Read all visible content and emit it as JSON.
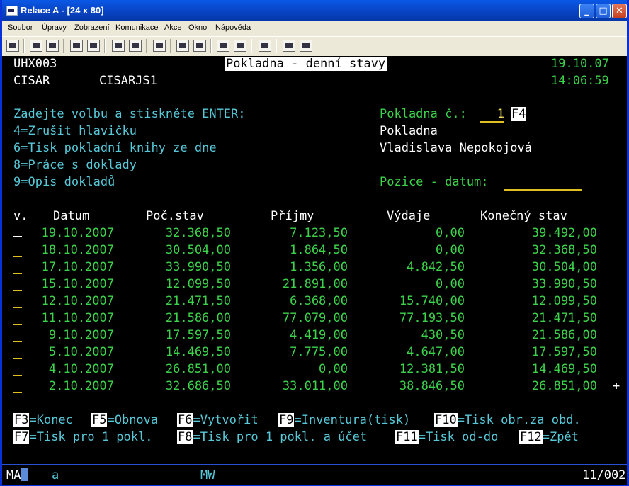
{
  "window": {
    "title": "Relace A - [24 x 80]"
  },
  "menu": [
    "Soubor",
    "Úpravy",
    "Zobrazení",
    "Komunikace",
    "Akce",
    "Okno",
    "Nápověda"
  ],
  "toolbar_icons": [
    "send-icon",
    "copy-icon",
    "paste-icon",
    "transfer-send-icon",
    "transfer-receive-icon",
    "display-icon",
    "display2-icon",
    "chart-icon",
    "record-start-icon",
    "record-stop-icon",
    "playback-icon",
    "playback2-icon",
    "clipboard-icon",
    "globe-icon",
    "tag-icon"
  ],
  "screen": {
    "program": "UHX003",
    "screen_title": "Pokladna - denní stavy",
    "date": "19.10.07",
    "user": "CISAR",
    "device": "CISARJS1",
    "time": "14:06:59",
    "instructions": [
      "Zadejte volbu a stiskněte ENTER:",
      "4=Zrušit hlavičku",
      "6=Tisk pokladní knihy ze dne",
      "8=Práce s doklady",
      "9=Opis dokladů"
    ],
    "register_label": "Pokladna č.:",
    "register_value": "1",
    "register_key": "F4",
    "register_name_label": "Pokladna",
    "register_owner": "Vladislava Nepokojová",
    "position_label": "Pozice - datum:",
    "position_value": "",
    "columns": [
      "v.",
      "Datum",
      "Poč.stav",
      "Příjmy",
      "Výdaje",
      "Konečný stav"
    ],
    "rows": [
      {
        "date": "19.10.2007",
        "start": "32.368,50",
        "income": "7.123,50",
        "expense": "0,00",
        "end": "39.492,00"
      },
      {
        "date": "18.10.2007",
        "start": "30.504,00",
        "income": "1.864,50",
        "expense": "0,00",
        "end": "32.368,50"
      },
      {
        "date": "17.10.2007",
        "start": "33.990,50",
        "income": "1.356,00",
        "expense": "4.842,50",
        "end": "30.504,00"
      },
      {
        "date": "15.10.2007",
        "start": "12.099,50",
        "income": "21.891,00",
        "expense": "0,00",
        "end": "33.990,50"
      },
      {
        "date": "12.10.2007",
        "start": "21.471,50",
        "income": "6.368,00",
        "expense": "15.740,00",
        "end": "12.099,50"
      },
      {
        "date": "11.10.2007",
        "start": "21.586,00",
        "income": "77.079,00",
        "expense": "77.193,50",
        "end": "21.471,50"
      },
      {
        "date": "9.10.2007",
        "start": "17.597,50",
        "income": "4.419,00",
        "expense": "430,50",
        "end": "21.586,00"
      },
      {
        "date": "5.10.2007",
        "start": "14.469,50",
        "income": "7.775,00",
        "expense": "4.647,00",
        "end": "17.597,50"
      },
      {
        "date": "4.10.2007",
        "start": "26.851,00",
        "income": "0,00",
        "expense": "12.381,50",
        "end": "14.469,50"
      },
      {
        "date": "2.10.2007",
        "start": "32.686,50",
        "income": "33.011,00",
        "expense": "38.846,50",
        "end": "26.851,00"
      }
    ],
    "more_indicator": "+",
    "fkeys_line1": [
      {
        "key": "F3",
        "label": "=Konec"
      },
      {
        "key": "F5",
        "label": "=Obnova"
      },
      {
        "key": "F6",
        "label": "=Vytvořit"
      },
      {
        "key": "F9",
        "label": "=Inventura(tisk)"
      },
      {
        "key": "F10",
        "label": "=Tisk obr.za obd."
      }
    ],
    "fkeys_line2": [
      {
        "key": "F7",
        "label": "=Tisk pro 1 pokl."
      },
      {
        "key": "F8",
        "label": "=Tisk pro 1 pokl. a účet"
      },
      {
        "key": "F11",
        "label": "=Tisk od-do"
      },
      {
        "key": "F12",
        "label": "=Zpět"
      }
    ]
  },
  "status": {
    "mode": "MA",
    "indicator": "a",
    "mw": "MW",
    "cursor_pos": "11/002"
  },
  "colors": {
    "green": "#3cd34b",
    "cyan": "#56c8d8",
    "white": "#ffffff",
    "yellow": "#f0e060"
  }
}
